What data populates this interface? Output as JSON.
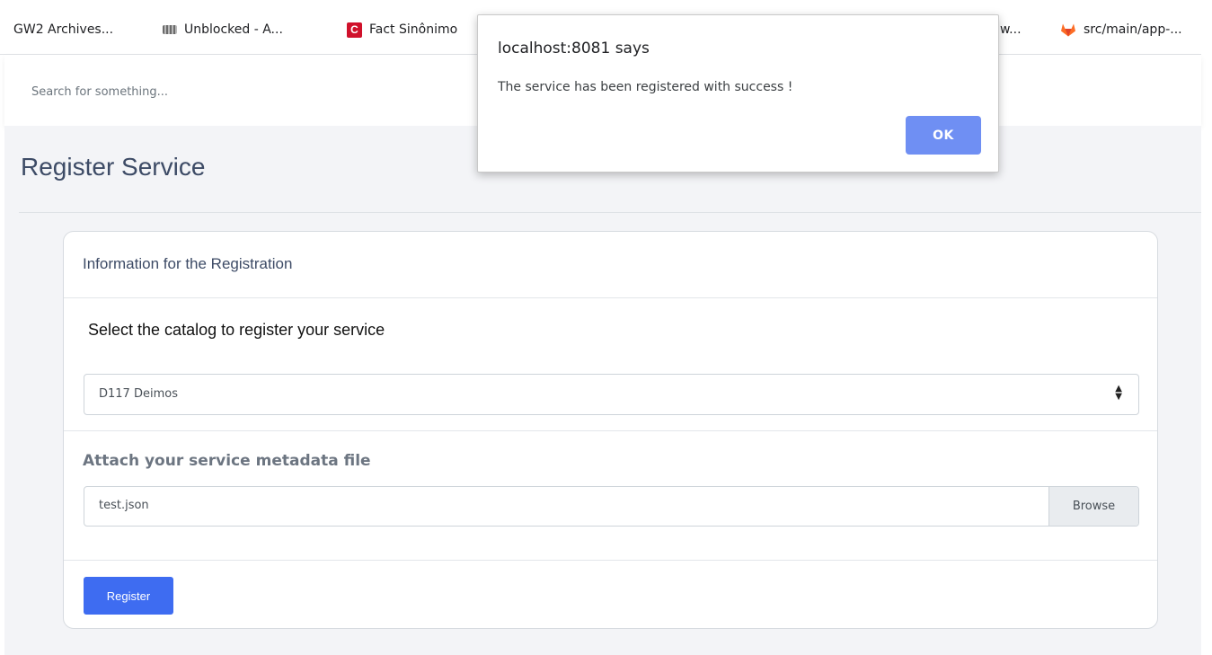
{
  "bookmarks": [
    {
      "label": "GW2 Archives...",
      "icon": "none"
    },
    {
      "label": "Unblocked - A...",
      "icon": "unblocked-icon"
    },
    {
      "label": "Fact Sinônimo",
      "icon": "c-icon"
    },
    {
      "label": "w...",
      "icon": "none"
    },
    {
      "label": "src/main/app-...",
      "icon": "gitlab-icon"
    }
  ],
  "search": {
    "placeholder": "Search for something..."
  },
  "page": {
    "title": "Register Service"
  },
  "card": {
    "header": "Information for the Registration",
    "select_label": "Select the catalog to register your service",
    "select_value": "D117 Deimos",
    "attach_label": "Attach your service metadata file",
    "file_name": "test.json",
    "browse_label": "Browse",
    "register_label": "Register"
  },
  "dialog": {
    "title": "localhost:8081 says",
    "message": "The service has been registered with success !",
    "ok_label": "OK"
  },
  "colors": {
    "primary": "#3e6cf1",
    "dialog_button": "#6f8ff3",
    "title_text": "#3d4b66",
    "content_bg": "#f3f4f7",
    "brand_c": "#d0112b",
    "gitlab": "#fc6d26"
  }
}
